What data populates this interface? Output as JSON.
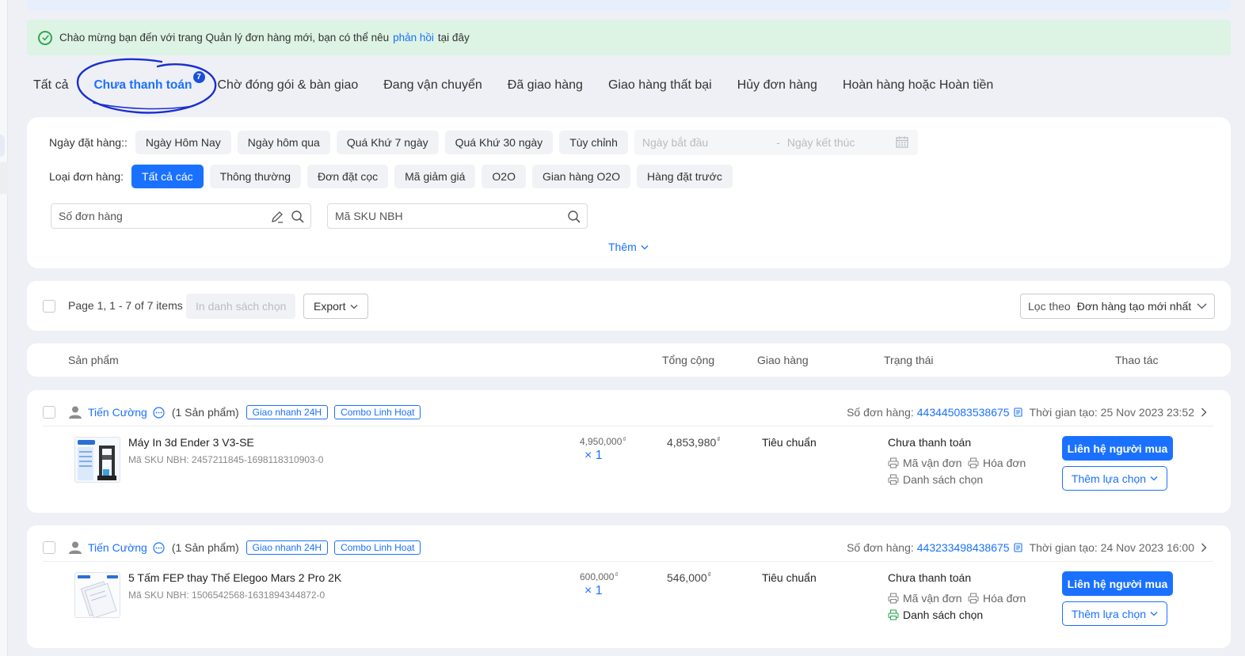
{
  "welcome": {
    "text_before": "Chào mừng bạn đến với trang Quản lý đơn hàng mới, bạn có thể nêu",
    "link": "phản hồi",
    "text_after": "tại đây"
  },
  "tabs": [
    {
      "label": "Tất cả"
    },
    {
      "label": "Chưa thanh toán",
      "badge": "7",
      "active": true
    },
    {
      "label": "Chờ đóng gói & bàn giao"
    },
    {
      "label": "Đang vận chuyển"
    },
    {
      "label": "Đã giao hàng"
    },
    {
      "label": "Giao hàng thất bại"
    },
    {
      "label": "Hủy đơn hàng"
    },
    {
      "label": "Hoàn hàng hoặc Hoàn tiền"
    }
  ],
  "filters": {
    "date_label": "Ngày đặt hàng::",
    "date_chips": [
      "Ngày Hôm Nay",
      "Ngày hôm qua",
      "Quá Khứ 7 ngày",
      "Quá Khứ 30 ngày",
      "Tùy chỉnh"
    ],
    "start_placeholder": "Ngày bắt đầu",
    "range_sep": "-",
    "end_placeholder": "Ngày kết thúc",
    "type_label": "Loại đơn hàng:",
    "type_chips": [
      "Tất cả các",
      "Thông thường",
      "Đơn đặt cọc",
      "Mã giảm giá",
      "O2O",
      "Gian hàng O2O",
      "Hàng đặt trước"
    ],
    "order_search_placeholder": "Số đơn hàng",
    "sku_search_placeholder": "Mã SKU NBH",
    "more": "Thêm"
  },
  "toolbar": {
    "page_info": "Page 1, 1 - 7 of 7 items",
    "print_pick": "In danh sách chọn",
    "export": "Export",
    "sort_label": "Lọc theo",
    "sort_value": "Đơn hàng tạo mới nhất"
  },
  "columns": {
    "product": "Sản phẩm",
    "total": "Tổng cộng",
    "shipping": "Giao hàng",
    "status": "Trạng thái",
    "actions": "Thao tác"
  },
  "orders": [
    {
      "buyer": "Tiến Cường",
      "count": "(1 Sản phẩm)",
      "tags": [
        "Giao nhanh 24H",
        "Combo Linh Hoạt"
      ],
      "order_label": "Số đơn hàng:",
      "order_no": "443445083538675",
      "created": "Thời gian tạo: 25 Nov 2023 23:52",
      "product_name": "Máy In 3d Ender 3 V3-SE",
      "sku": "Mã SKU NBH: 2457211845-1698118310903-0",
      "orig_price": "4,950,000",
      "qty": "× 1",
      "total": "4,853,980",
      "currency": "₫",
      "shipping": "Tiêu chuẩn",
      "status": "Chưa thanh toán",
      "link_waybill": "Mã vận đơn",
      "link_invoice": "Hóa đơn",
      "link_picklist": "Danh sách chọn",
      "picklist_color": "#8a8a8a",
      "contact": "Liên hệ người mua",
      "more": "Thêm lựa chọn"
    },
    {
      "buyer": "Tiến Cường",
      "count": "(1 Sản phẩm)",
      "tags": [
        "Giao nhanh 24H",
        "Combo Linh Hoạt"
      ],
      "order_label": "Số đơn hàng:",
      "order_no": "443233498438675",
      "created": "Thời gian tạo: 24 Nov 2023 16:00",
      "product_name": "5 Tấm FEP thay Thế Elegoo Mars 2 Pro 2K",
      "sku": "Mã SKU NBH: 1506542568-1631894344872-0",
      "orig_price": "600,000",
      "qty": "× 1",
      "total": "546,000",
      "currency": "₫",
      "shipping": "Tiêu chuẩn",
      "status": "Chưa thanh toán",
      "link_waybill": "Mã vận đơn",
      "link_invoice": "Hóa đơn",
      "link_picklist": "Danh sách chọn",
      "picklist_color": "#2fa654",
      "contact": "Liên hệ người mua",
      "more": "Thêm lựa chọn"
    }
  ],
  "colors": {
    "accent": "#1a71ff",
    "welcome_bg": "#ddf3e4",
    "annotation": "#1a2fd0"
  }
}
